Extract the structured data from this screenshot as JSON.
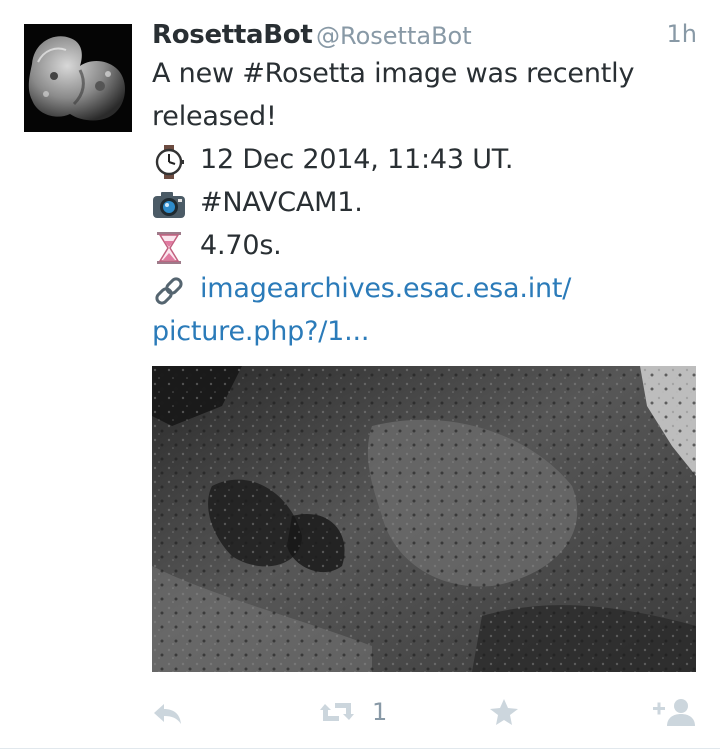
{
  "tweet": {
    "name": "RosettaBot",
    "handle": "@RosettaBot",
    "time": "1h",
    "text_line1": "A new #Rosetta image was recently",
    "text_line2": "released!",
    "date_text": "12 Dec 2014, 11:43 UT.",
    "camera_text": "#NAVCAM1.",
    "exposure_text": "4.70s.",
    "link_line1": "imagearchives.esac.esa.int/",
    "link_line2": "picture.php?/1..."
  },
  "icons": {
    "watch": "watch-icon",
    "camera": "camera-icon",
    "hourglass": "hourglass-icon",
    "link": "link-icon"
  },
  "actions": {
    "retweet_count": "1"
  },
  "colors": {
    "name": "#292f33",
    "muted": "#8899a6",
    "link": "#2b7bb9",
    "action_icon": "#ccd6dd"
  }
}
